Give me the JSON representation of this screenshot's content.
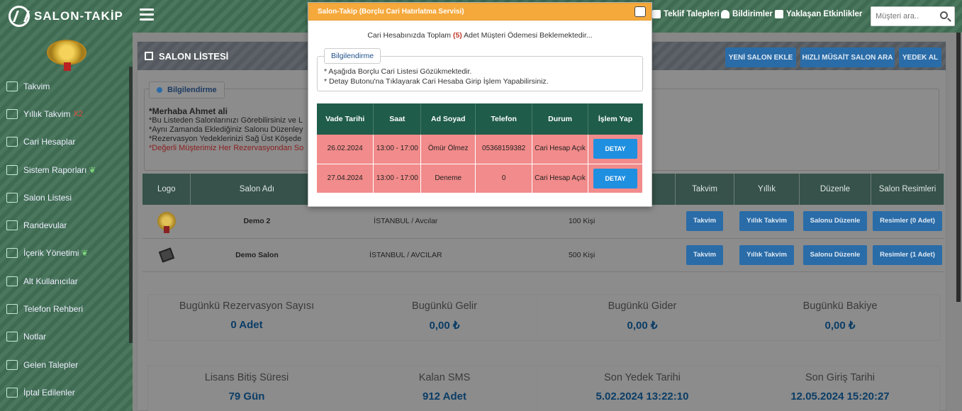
{
  "brand": {
    "name": "SALON-TAKİP"
  },
  "topbar": {
    "links": [
      "Teklif Talepleri",
      "Bildirimler",
      "Yaklaşan Etkinlikler"
    ],
    "search_placeholder": "Müşteri ara.."
  },
  "sidebar": {
    "items": [
      {
        "label": "Takvim",
        "icon": "calendar-icon"
      },
      {
        "label": "Yıllık Takvim",
        "extra": "X2",
        "icon": "calendar-grid-icon"
      },
      {
        "label": "Cari Hesaplar",
        "icon": "building-icon"
      },
      {
        "label": "Sistem Raporları",
        "icon": "chart-icon"
      },
      {
        "label": "Salon Listesi",
        "icon": "bar-chart-icon"
      },
      {
        "label": "Randevular",
        "icon": "handshake-icon"
      },
      {
        "label": "İçerik Yönetimi",
        "icon": "list-icon"
      },
      {
        "label": "Alt Kullanıcılar",
        "icon": "users-icon"
      },
      {
        "label": "Telefon Rehberi",
        "icon": "phone-book-icon"
      },
      {
        "label": "Notlar",
        "icon": "note-icon"
      },
      {
        "label": "Gelen Talepler",
        "icon": "inbox-icon"
      },
      {
        "label": "İptal Edilenler",
        "icon": "cancel-icon"
      }
    ]
  },
  "panel": {
    "title": "SALON LİSTESİ",
    "buttons": [
      "YENİ SALON EKLE",
      "HIZLI MÜSAİT SALON ARA",
      "YEDEK AL"
    ],
    "info_tab": "Bilgilendirme",
    "info": {
      "hello": "*Merhaba Ahmet ali",
      "l1": "*Bu Listeden Salonlarınızı Görebilirsiniz ve L",
      "l2": "*Aynı Zamanda Eklediğiniz Salonu Düzenley",
      "l3": "*Rezervasyon Yedeklerinizi Sağ Üst Köşede",
      "l4": "*Değerli Müşterimiz Her Rezervasyondan So"
    }
  },
  "salon_table": {
    "headers": [
      "Logo",
      "Salon Adı",
      "",
      "",
      "Takvim",
      "Yıllık",
      "Düzenle",
      "Salon Resimleri"
    ],
    "rows": [
      {
        "name": "Demo 2",
        "location": "İSTANBUL / Avcılar",
        "capacity": "100 Kişi",
        "takvim": "Takvim",
        "yillik": "Yıllık Takvim",
        "duzenle": "Salonu Düzenle",
        "resimler": "Resimler (0 Adet)"
      },
      {
        "name": "Demo Salon",
        "location": "İSTANBUL / AVCILAR",
        "capacity": "500 Kişi",
        "takvim": "Takvim",
        "yillik": "Yıllık Takvim",
        "duzenle": "Salonu Düzenle",
        "resimler": "Resimler (1 Adet)"
      }
    ]
  },
  "stats1": [
    {
      "label": "Bugünkü Rezervasyon Sayısı",
      "value": "0 Adet"
    },
    {
      "label": "Bugünkü Gelir",
      "value": "0,00 ₺"
    },
    {
      "label": "Bugünkü Gider",
      "value": "0,00 ₺"
    },
    {
      "label": "Bugünkü Bakiye",
      "value": "0,00 ₺"
    }
  ],
  "stats2": [
    {
      "label": "Lisans Bitiş Süresi",
      "value": "79 Gün"
    },
    {
      "label": "Kalan SMS",
      "value": "912 Adet"
    },
    {
      "label": "Son Yedek Tarihi",
      "value": "5.02.2024 13:22:10"
    },
    {
      "label": "Son Giriş Tarihi",
      "value": "12.05.2024 15:20:27"
    }
  ],
  "modal": {
    "title": "Salon-Takip (Borçlu Cari Hatırlatma Servisi)",
    "summary_pre": "Cari Hesabınızda Toplam",
    "summary_count": "(5)",
    "summary_post": "Adet Müşteri Ödemesi Beklemektedir...",
    "info_tab": "Bilgilendirme",
    "info_l1": "* Aşağıda Borçlu Cari Listesi Gözükmektedir.",
    "info_l2": "* Detay Butonu'na Tıklayarak Cari Hesaba Girip İşlem Yapabilirsiniz.",
    "headers": [
      "Vade Tarihi",
      "Saat",
      "Ad Soyad",
      "Telefon",
      "Durum",
      "İşlem Yap"
    ],
    "rows": [
      {
        "vade": "26.02.2024",
        "saat": "13:00 - 17:00",
        "ad": "Ömür Ölmez",
        "tel": "05368159382",
        "durum": "Cari Hesap Açık",
        "btn": "DETAY"
      },
      {
        "vade": "27.04.2024",
        "saat": "13:00 - 17:00",
        "ad": "Deneme",
        "tel": "0",
        "durum": "Cari Hesap Açık",
        "btn": "DETAY"
      }
    ]
  }
}
